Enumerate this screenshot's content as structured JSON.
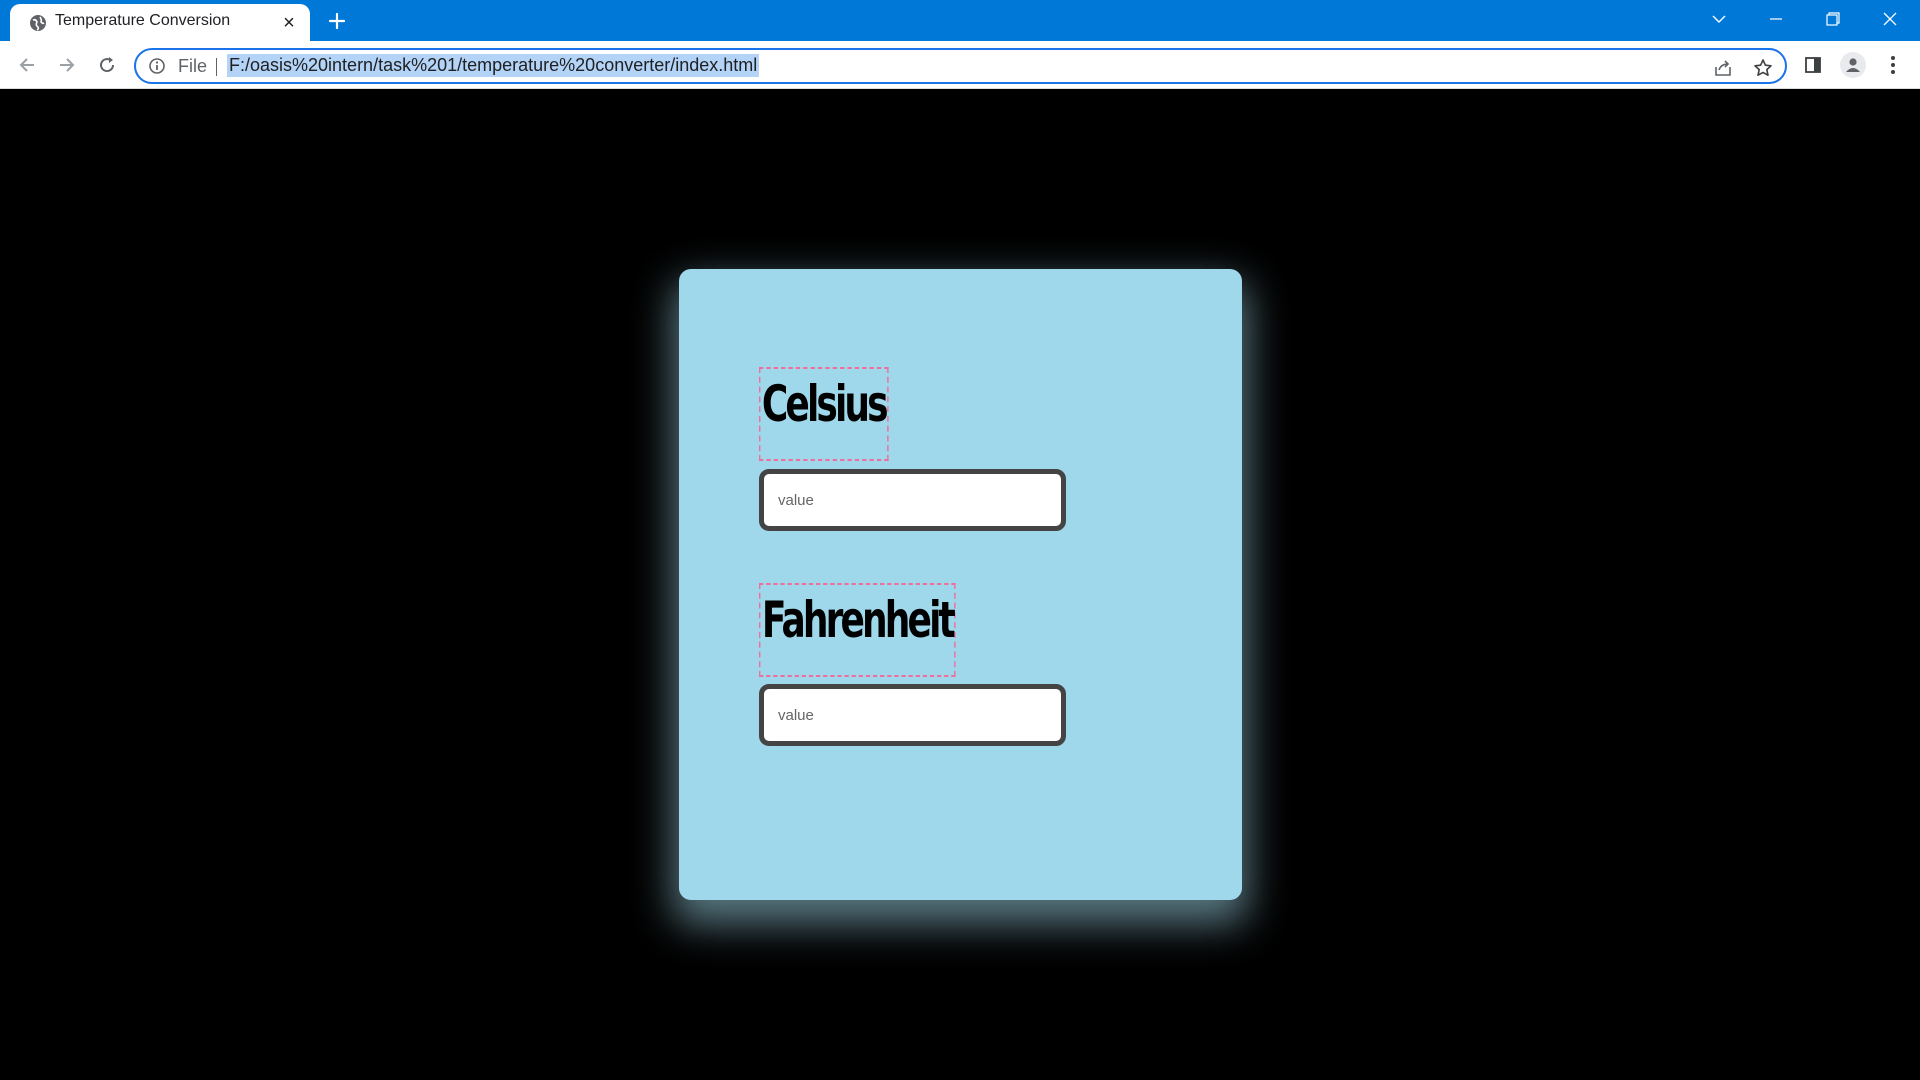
{
  "browser": {
    "tab": {
      "title": "Temperature Conversion",
      "close_glyph": "×"
    },
    "omnibox": {
      "scheme_label": "File",
      "url": "F:/oasis%20intern/task%201/temperature%20converter/index.html"
    },
    "icons": {
      "favicon": "globe-icon",
      "new_tab": "plus-icon",
      "back": "arrow-left-icon",
      "forward": "arrow-right-icon",
      "reload": "reload-icon",
      "info": "info-icon",
      "share": "share-icon",
      "bookmark": "star-icon",
      "side_panel": "side-panel-icon",
      "profile": "profile-icon",
      "menu": "kebab-menu-icon",
      "tab_search": "chevron-down-icon",
      "minimize": "minimize-icon",
      "restore": "restore-icon",
      "close": "close-icon"
    },
    "colors": {
      "titlebar": "#0078d7",
      "focus_ring": "#1a73e8",
      "selection": "#b4d4f7"
    }
  },
  "page": {
    "celsius": {
      "label": "Celsius",
      "placeholder": "value",
      "value": ""
    },
    "fahrenheit": {
      "label": "Fahrenheit",
      "placeholder": "value",
      "value": ""
    },
    "colors": {
      "background": "#000000",
      "card": "#a0d8eb",
      "label_border": "#ee6f9d",
      "input_border": "#444444"
    }
  }
}
